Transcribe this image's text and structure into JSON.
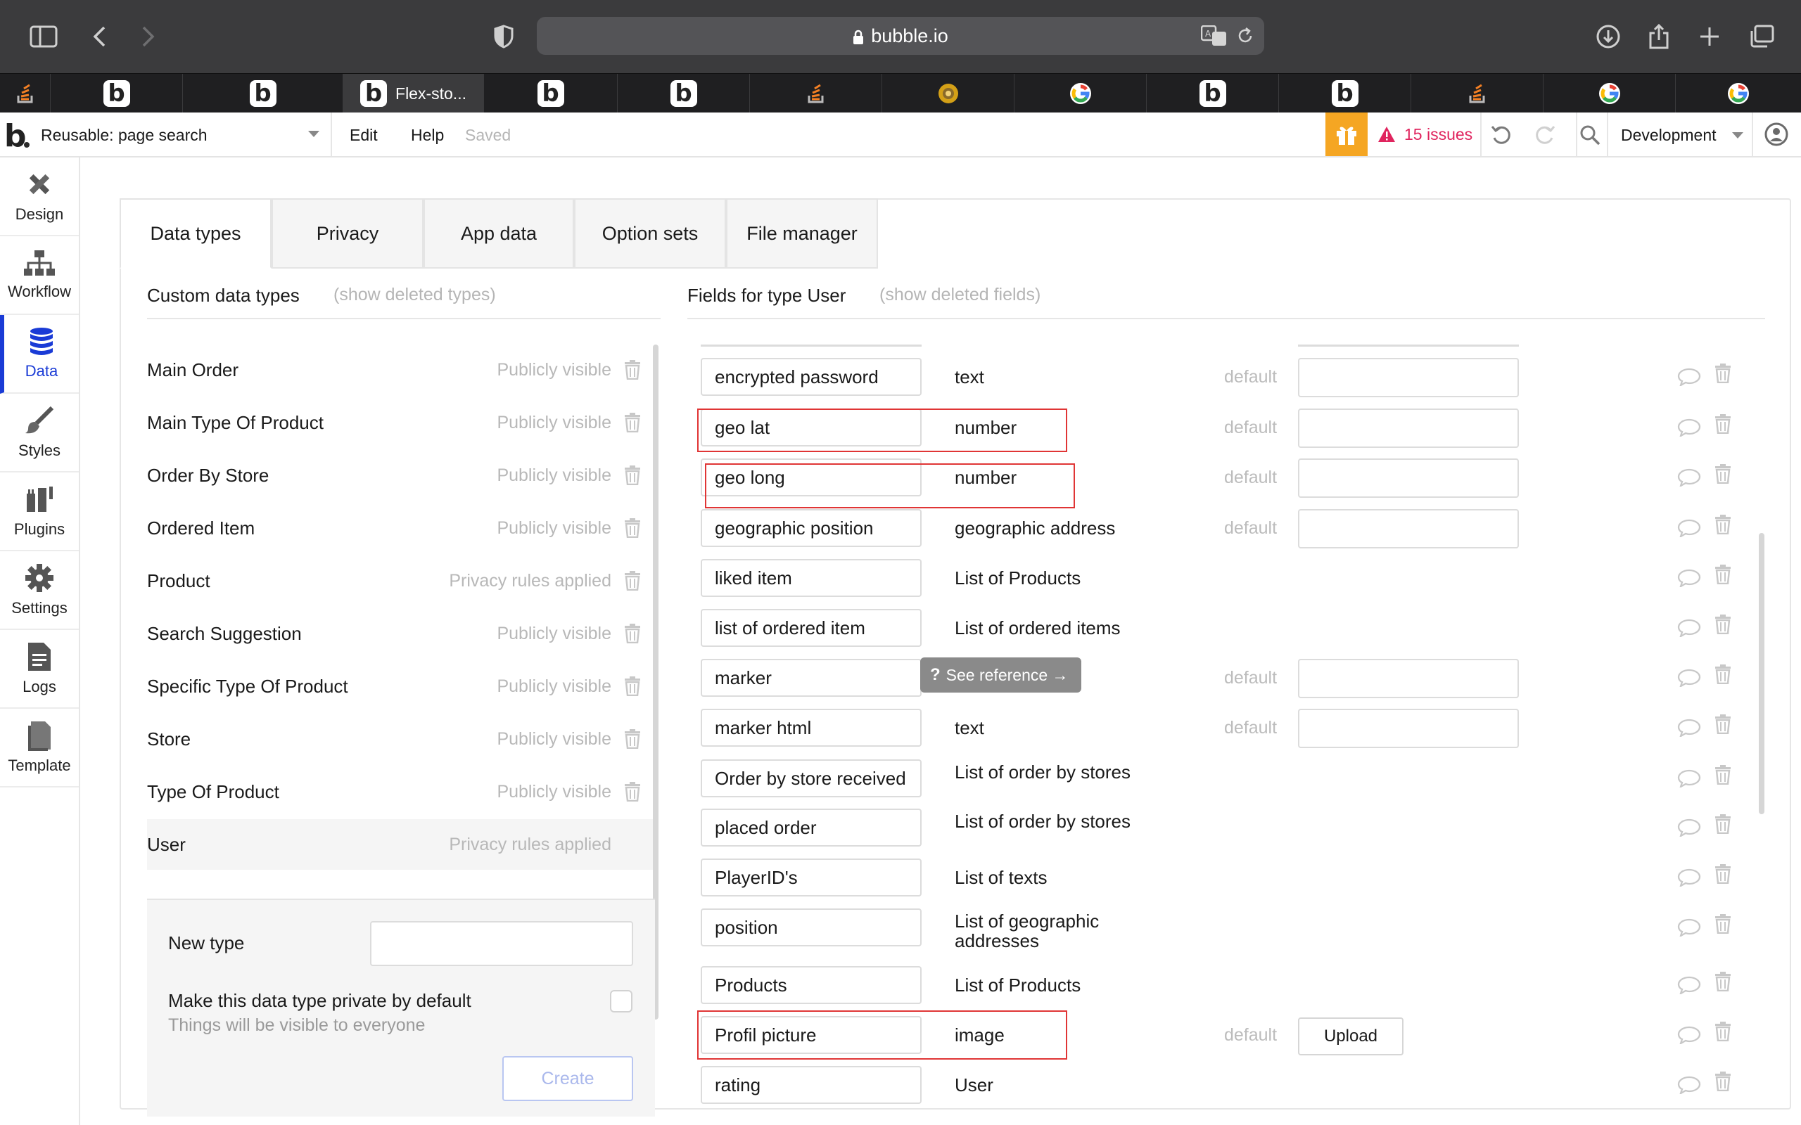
{
  "browser": {
    "url": "bubble.io",
    "active_tab_title": "Flex-sto...",
    "tabs": [
      {
        "icon": "stackoverflow-icon"
      },
      {
        "icon": "bubble-b-icon"
      },
      {
        "icon": "bubble-b-icon"
      },
      {
        "icon": "bubble-b-icon",
        "title": "Flex-sto..."
      },
      {
        "icon": "bubble-b-icon"
      },
      {
        "icon": "bubble-b-icon"
      },
      {
        "icon": "stackoverflow-icon"
      },
      {
        "icon": "chrome-store-icon"
      },
      {
        "icon": "google-icon"
      },
      {
        "icon": "bubble-b-icon"
      },
      {
        "icon": "bubble-b-icon"
      },
      {
        "icon": "stackoverflow-icon"
      },
      {
        "icon": "google-icon"
      },
      {
        "icon": "google-icon"
      }
    ]
  },
  "header": {
    "page_selector": "Reusable: page search",
    "menu": [
      "Edit",
      "Help"
    ],
    "status": "Saved",
    "issues": "15 issues",
    "environment": "Development",
    "colors": {
      "gift": "#f5a623",
      "issues": "#e0245e",
      "accent": "#1a3bd6"
    }
  },
  "leftnav": [
    "Design",
    "Workflow",
    "Data",
    "Styles",
    "Plugins",
    "Settings",
    "Logs",
    "Template"
  ],
  "main_tabs": [
    "Data types",
    "Privacy",
    "App data",
    "Option sets",
    "File manager"
  ],
  "custom_types": {
    "title": "Custom data types",
    "show_deleted": "(show deleted types)",
    "items": [
      {
        "name": "Main Order",
        "visibility": "Publicly visible"
      },
      {
        "name": "Main Type Of Product",
        "visibility": "Publicly visible"
      },
      {
        "name": "Order By Store",
        "visibility": "Publicly visible"
      },
      {
        "name": "Ordered Item",
        "visibility": "Publicly visible"
      },
      {
        "name": "Product",
        "visibility": "Privacy rules applied"
      },
      {
        "name": "Search Suggestion",
        "visibility": "Publicly visible"
      },
      {
        "name": "Specific Type Of Product",
        "visibility": "Publicly visible"
      },
      {
        "name": "Store",
        "visibility": "Publicly visible"
      },
      {
        "name": "Type Of Product",
        "visibility": "Publicly visible"
      },
      {
        "name": "User",
        "visibility": "Privacy rules applied"
      }
    ]
  },
  "new_type": {
    "label": "New type",
    "input_value": "",
    "private_label": "Make this data type private by default",
    "private_hint": "Things will be visible to everyone",
    "create_label": "Create"
  },
  "fields": {
    "title": "Fields for type User",
    "show_deleted": "(show deleted fields)",
    "default_label": "default",
    "tooltip": "See reference →",
    "upload_label": "Upload",
    "items": [
      {
        "name": "encrypted password",
        "type": "text",
        "has_default": true
      },
      {
        "name": "geo lat",
        "type": "number",
        "has_default": true
      },
      {
        "name": "geo long",
        "type": "number",
        "has_default": true
      },
      {
        "name": "geographic position",
        "type": "geographic address",
        "has_default": true
      },
      {
        "name": "liked item",
        "type": "List of Products",
        "has_default": false
      },
      {
        "name": "list of ordered item",
        "type": "List of ordered items",
        "has_default": false
      },
      {
        "name": "marker",
        "type": "",
        "has_default": true
      },
      {
        "name": "marker html",
        "type": "text",
        "has_default": true
      },
      {
        "name": "Order by store received",
        "type": "List of order by stores",
        "has_default": false
      },
      {
        "name": "placed order",
        "type": "List of order by stores",
        "has_default": false
      },
      {
        "name": "PlayerID's",
        "type": "List of texts",
        "has_default": false
      },
      {
        "name": "position",
        "type": "List of geographic addresses",
        "has_default": false
      },
      {
        "name": "Products",
        "type": "List of Products",
        "has_default": false
      },
      {
        "name": "Profil picture",
        "type": "image",
        "has_default": true
      },
      {
        "name": "rating",
        "type": "User",
        "has_default": false
      }
    ]
  }
}
